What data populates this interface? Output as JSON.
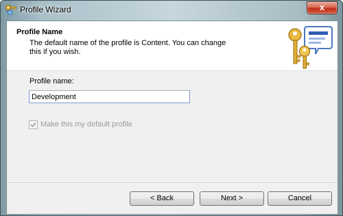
{
  "window": {
    "title": "Profile Wizard",
    "icon": "key-profile-icon",
    "close_label": "x"
  },
  "header": {
    "title": "Profile Name",
    "description": "The default name of the profile is Content. You can change this if you wish.",
    "art": "keys-chat-bubble-icon"
  },
  "form": {
    "name_label": "Profile name:",
    "name_value": "Development",
    "default_checkbox_label": "Make this my default profile",
    "default_checked": true,
    "default_enabled": false
  },
  "buttons": {
    "back": "< Back",
    "next": "Next >",
    "cancel": "Cancel"
  },
  "colors": {
    "close_button": "#c0311a",
    "header_bg": "#ffffff",
    "client_bg": "#f0f0f0"
  }
}
